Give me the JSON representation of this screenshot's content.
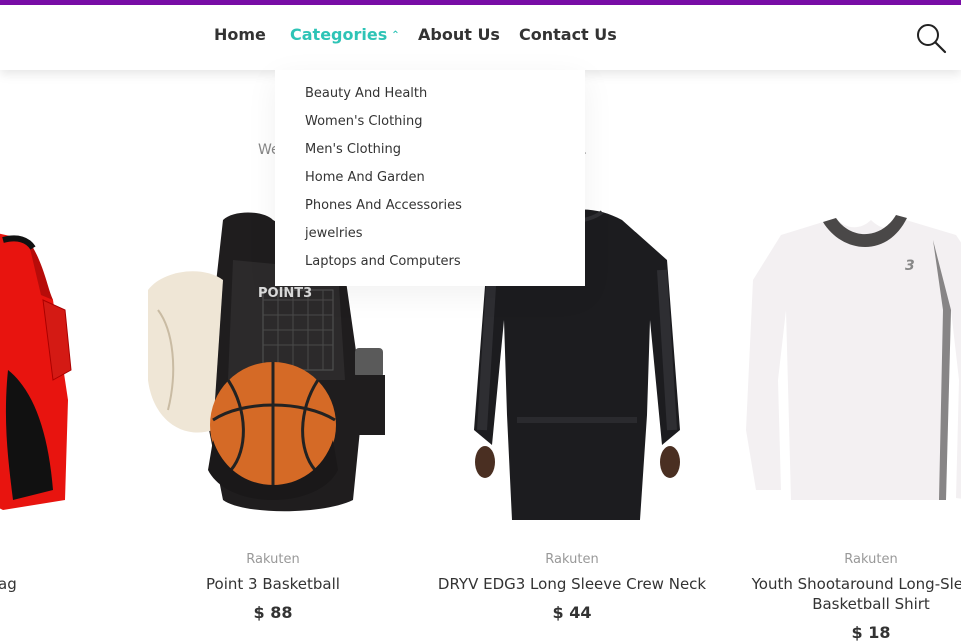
{
  "nav": {
    "items": [
      {
        "label": "Home"
      },
      {
        "label": "Categories",
        "active": true
      },
      {
        "label": "About Us"
      },
      {
        "label": "Contact Us"
      }
    ],
    "caret": "⌃",
    "search_icon": "search-icon"
  },
  "intro": {
    "text": "We l",
    "text_end": "e."
  },
  "categories_menu": {
    "items": [
      "Beauty And Health",
      "Women's Clothing",
      "Men's Clothing",
      "Home And Garden",
      "Phones And Accessories",
      "jewelries",
      "Laptops and Computers"
    ]
  },
  "products": [
    {
      "brand": "",
      "name": "ts Bag",
      "price": ""
    },
    {
      "brand": "Rakuten",
      "name": "Point 3 Basketball",
      "price": "$ 88"
    },
    {
      "brand": "Rakuten",
      "name": "DRYV EDG3 Long Sleeve Crew Neck",
      "price": "$ 44"
    },
    {
      "brand": "Rakuten",
      "name": "Youth Shootaround Long-Sleeve Basketball Shirt",
      "price": "$ 18"
    }
  ],
  "colors": {
    "accent": "#2ec4b6",
    "top_stripe": "#7a0ea8"
  }
}
